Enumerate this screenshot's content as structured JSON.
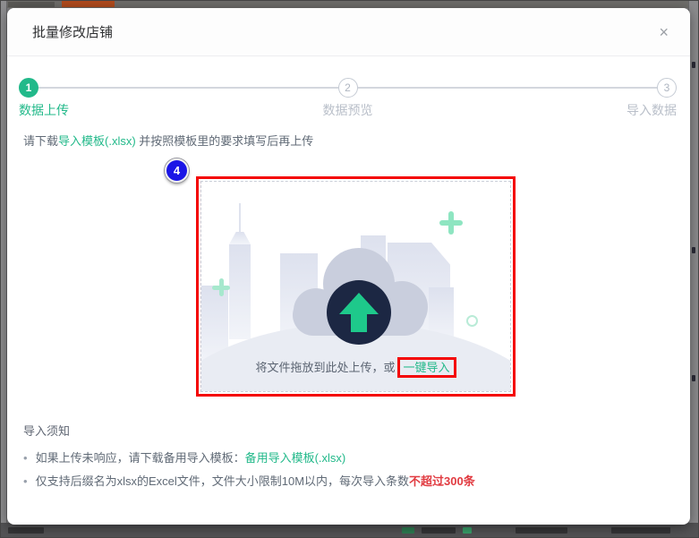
{
  "dialog": {
    "title": "批量修改店铺",
    "close_icon": "×"
  },
  "stepper": {
    "steps": [
      {
        "number": "1",
        "label": "数据上传",
        "state": "active"
      },
      {
        "number": "2",
        "label": "数据预览",
        "state": "pending"
      },
      {
        "number": "3",
        "label": "导入数据",
        "state": "pending"
      }
    ]
  },
  "instructions": {
    "prefix": "请下载",
    "template_link": "导入模板(.xlsx)",
    "suffix": " 并按照模板里的要求填写后再上传"
  },
  "annotation": {
    "label": "4"
  },
  "upload": {
    "drop_text": "将文件拖放到此处上传，或",
    "import_link": "一键导入"
  },
  "notice": {
    "title": "导入须知",
    "items": [
      {
        "text": "如果上传未响应，请下载备用导入模板：",
        "link": "备用导入模板(.xlsx)"
      },
      {
        "text": "仅支持后缀名为xlsx的Excel文件，文件大小限制10M以内，每次导入条数",
        "highlight": "不超过300条"
      }
    ]
  },
  "colors": {
    "accent_green": "#22b98a",
    "annotation_red": "#f40505",
    "annotation_blue": "#1b16e6",
    "warning_red": "#e13b41"
  }
}
